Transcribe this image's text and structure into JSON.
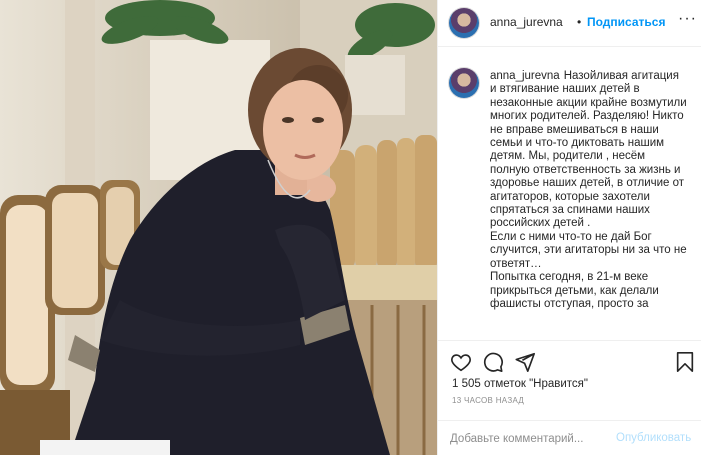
{
  "photo": {
    "alt_name": "post-photo"
  },
  "header": {
    "username": "anna_jurevna",
    "separator": "•",
    "follow_label": "Подписаться",
    "more_icon": "more-horizontal-icon",
    "more_glyph": "···"
  },
  "caption": {
    "username": "anna_jurevna",
    "text": "Назойливая агитация и втягивание наших детей в незаконные акции крайне возмутили многих родителей. Разделяю! Никто не вправе вмешиваться в наши семьи и что-то диктовать нашим детям. Мы, родители , несём полную ответственность за жизнь и здоровье наших детей, в отличие от агитаторов, которые захотели спрятаться за спинами наших российских детей .\nЕсли с ними что-то не дай Бог случится, эти агитаторы ни за что не ответят…\nПопытка сегодня, в 21-м веке прикрыться детьми, как делали фашисты отступая, просто за"
  },
  "actions": {
    "like_icon": "heart-icon",
    "comment_icon": "comment-icon",
    "share_icon": "share-icon",
    "save_icon": "bookmark-icon"
  },
  "likes_text": "1 505 отметок \"Нравится\"",
  "timestamp": "13 ЧАСОВ НАЗАД",
  "comment": {
    "placeholder": "Добавьте комментарий...",
    "publish_label": "Опубликовать"
  },
  "colors": {
    "accent": "#0095f6",
    "publish_disabled": "#b2dffc",
    "text": "#262626",
    "muted": "#8e8e8e",
    "border": "#efefef"
  }
}
